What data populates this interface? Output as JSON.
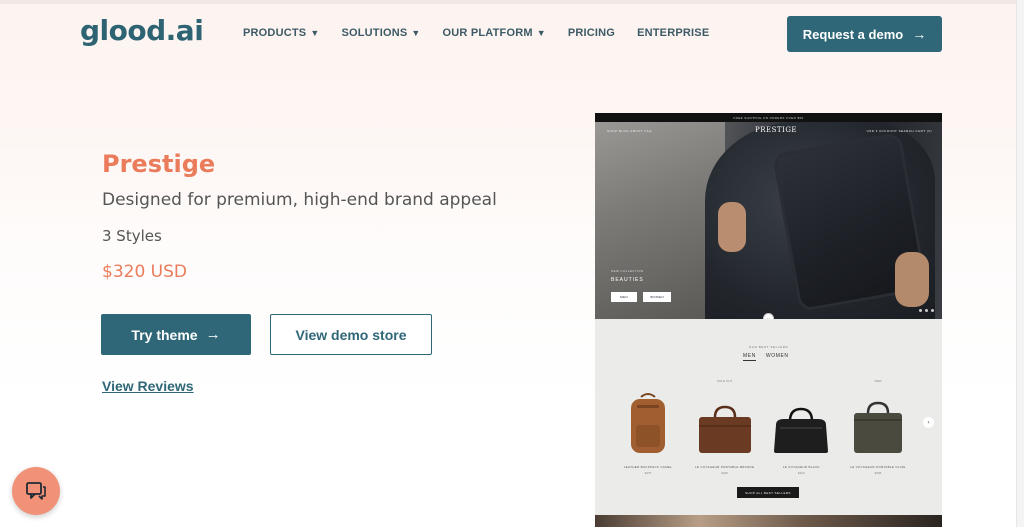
{
  "header": {
    "logo": "glood.ai",
    "nav": [
      {
        "label": "PRODUCTS",
        "caret": "▼"
      },
      {
        "label": "SOLUTIONS",
        "caret": "▼"
      },
      {
        "label": "OUR PLATFORM",
        "caret": "▼"
      },
      {
        "label": "PRICING",
        "caret": ""
      },
      {
        "label": "ENTERPRISE",
        "caret": ""
      }
    ],
    "cta_label": "Request a demo",
    "cta_icon": "arrow-right-icon"
  },
  "theme": {
    "name": "Prestige",
    "tagline": "Designed for premium, high-end brand appeal",
    "styles": "3 Styles",
    "price": "$320 USD",
    "try_label": "Try theme",
    "demo_label": "View demo store",
    "reviews_label": "View Reviews"
  },
  "chat": {
    "icon": "chat-icon"
  },
  "preview": {
    "topbar": "FREE SHIPPING ON ORDERS OVER $50",
    "nav_left": "SHOP  BLOG  ABOUT  FAQ",
    "brand": "PRESTIGE",
    "nav_right": "USD ▾   ACCOUNT   SEARCH   CART (0)",
    "eyebrow": "NEW COLLECTION",
    "headline": "BEAUTIES",
    "btn_men": "MEN",
    "btn_women": "WOMEN",
    "section_eyebrow": "OUR BEST SELLERS",
    "tab_men": "MEN",
    "tab_women": "WOMEN",
    "products": [
      {
        "name": "LEATHER BACKPACK CAMEL",
        "price": "$375",
        "badge": "",
        "color": "#9a5a2e"
      },
      {
        "name": "LE VOYAGEUR PORTABLE BRANDE",
        "price": "$420",
        "badge": "SOLD OUT",
        "color": "#6b3a22"
      },
      {
        "name": "LE VOYAGEUR BLACK",
        "price": "$420",
        "badge": "",
        "color": "#1e1e1e"
      },
      {
        "name": "LE VOYAGEUR PORTABLE OLIVE",
        "price": "$395",
        "badge": "NEW",
        "color": "#4b4a3e"
      }
    ],
    "shop_all": "SHOP ALL BEST SELLERS"
  }
}
